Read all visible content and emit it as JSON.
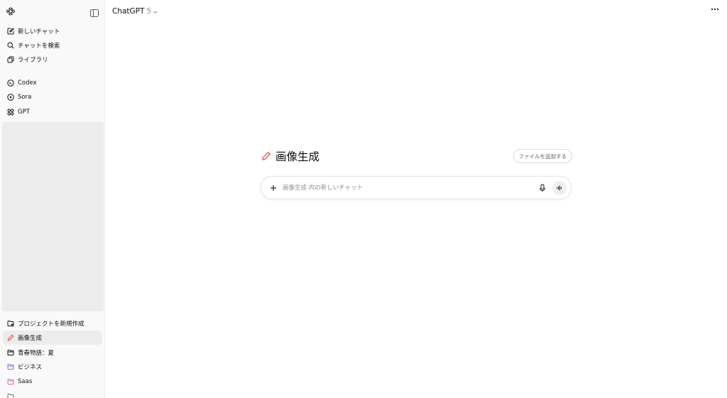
{
  "sidebar": {
    "nav": [
      {
        "label": "新しいチャット",
        "icon": "edit-icon"
      },
      {
        "label": "チャットを検索",
        "icon": "search-icon"
      },
      {
        "label": "ライブラリ",
        "icon": "library-icon"
      }
    ],
    "apps": [
      {
        "label": "Codex",
        "icon": "codex-icon"
      },
      {
        "label": "Sora",
        "icon": "play-icon"
      },
      {
        "label": "GPT",
        "icon": "grid-icon"
      }
    ],
    "projects": [
      {
        "label": "プロジェクトを新規作成",
        "icon": "new-folder-icon"
      },
      {
        "label": "画像生成",
        "icon": "pencil-icon",
        "active": true
      },
      {
        "label": "青春物語：夏",
        "icon": "folder-icon"
      },
      {
        "label": "ビジネス",
        "icon": "folder-icon"
      },
      {
        "label": "Saas",
        "icon": "folder-icon"
      }
    ]
  },
  "header": {
    "model_name": "ChatGPT",
    "model_version": "5"
  },
  "project": {
    "title": "画像生成",
    "add_files_label": "ファイルを追加する"
  },
  "composer": {
    "placeholder": "画像生成 内の新しいチャット",
    "value": ""
  },
  "colors": {
    "accent_red": "#e8453c",
    "folder_purple": "#9a6cf0",
    "folder_pink": "#e86ab3",
    "sidebar_bg": "#f9f9f9",
    "active_bg": "#ececec"
  }
}
